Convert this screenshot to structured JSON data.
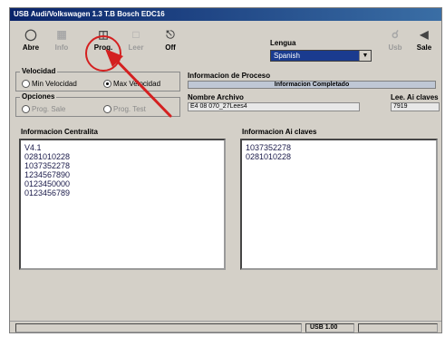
{
  "window": {
    "title": "USB Audi/Volkswagen 1.3 T.B Bosch EDC16"
  },
  "toolbar": {
    "buttons": [
      {
        "label": "Abre",
        "icon": "open-icon",
        "enabled": true
      },
      {
        "label": "Info",
        "icon": "info-icon",
        "enabled": false
      },
      {
        "label": "Prog.",
        "icon": "program-icon",
        "enabled": true
      },
      {
        "label": "Leer",
        "icon": "read-icon",
        "enabled": false
      },
      {
        "label": "Off",
        "icon": "power-off-icon",
        "enabled": true
      },
      {
        "label": "Usb",
        "icon": "usb-icon",
        "enabled": false
      },
      {
        "label": "Sale",
        "icon": "exit-icon",
        "enabled": true
      }
    ],
    "language_label": "Lengua",
    "language_value": "Spanish"
  },
  "velocidad": {
    "title": "Velocidad",
    "option_min": "Min Velocidad",
    "option_max": "Max Velocidad",
    "selected": "max"
  },
  "opciones": {
    "title": "Opciones",
    "option_a": "Prog. Sale",
    "option_b": "Prog. Test"
  },
  "proceso": {
    "label": "Informacion de Proceso",
    "status": "Informacion Completado",
    "filename_label": "Nombre Archivo",
    "filename_value": "E4 08 070_27Lees4",
    "keys_label": "Lee. Ai claves",
    "keys_value": "7919"
  },
  "centralita": {
    "label": "Informacion Centralita",
    "lines": [
      "V4.1",
      "0281010228",
      "1037352278",
      "1234567890",
      "0123450000",
      "0123456789"
    ]
  },
  "claves": {
    "label": "Informacion Ai claves",
    "lines": [
      "1037352278",
      "0281010228"
    ]
  },
  "status_bar": {
    "usb": "USB 1.00"
  },
  "annotation": {
    "color": "#d42020"
  }
}
